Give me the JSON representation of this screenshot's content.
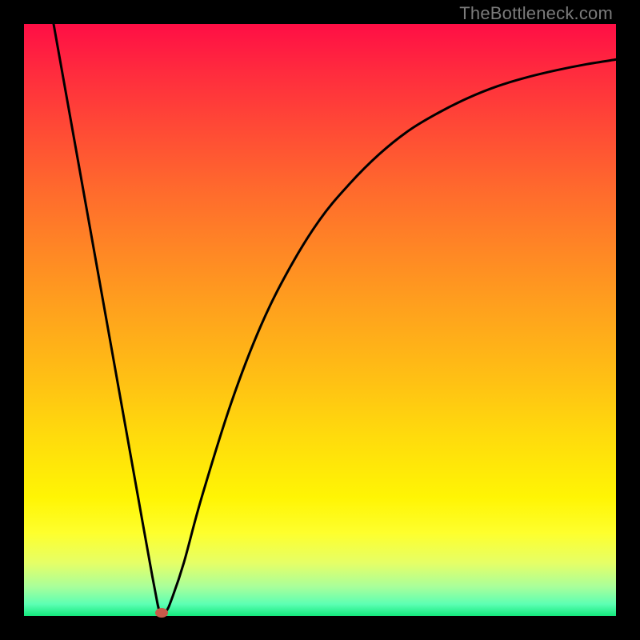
{
  "watermark": "TheBottleneck.com",
  "colors": {
    "gradient_top": "#ff0e45",
    "gradient_bottom": "#14e87c",
    "border": "#000000",
    "curve": "#000000",
    "marker": "#c85a4a",
    "watermark_text": "#7b7b7b"
  },
  "chart_data": {
    "type": "line",
    "title": "",
    "xlabel": "",
    "ylabel": "",
    "xlim": [
      0,
      100
    ],
    "ylim": [
      0,
      100
    ],
    "series": [
      {
        "name": "curve",
        "x": [
          5,
          10,
          15,
          20,
          22,
          23,
          24,
          25,
          27,
          30,
          35,
          40,
          45,
          50,
          55,
          60,
          65,
          70,
          75,
          80,
          85,
          90,
          95,
          100
        ],
        "y": [
          100,
          72,
          44,
          16,
          5,
          0.5,
          0.8,
          3,
          9,
          20,
          36,
          49,
          59,
          67,
          73,
          78,
          82,
          85,
          87.5,
          89.5,
          91,
          92.2,
          93.2,
          94
        ]
      }
    ],
    "marker": {
      "x": 23.3,
      "y": 0.6
    }
  }
}
